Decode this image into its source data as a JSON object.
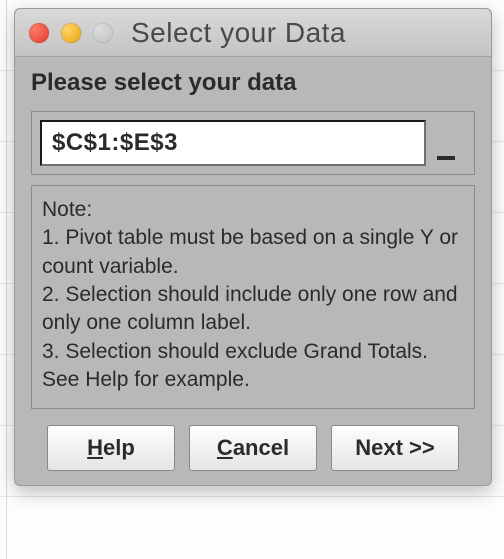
{
  "window": {
    "title": "Select your Data"
  },
  "prompt": "Please select your data",
  "range_input": {
    "value": "$C$1:$E$3"
  },
  "note": {
    "header": "Note:",
    "line1": " 1. Pivot table must be based on a single Y or count variable.",
    "line2": " 2. Selection should include only one row and only one column label.",
    "line3": " 3. Selection should exclude Grand Totals.",
    "footer": " See Help for example."
  },
  "buttons": {
    "help_prefix": "H",
    "help_rest": "elp",
    "cancel_prefix": "C",
    "cancel_rest": "ancel",
    "next": "Next >>"
  }
}
